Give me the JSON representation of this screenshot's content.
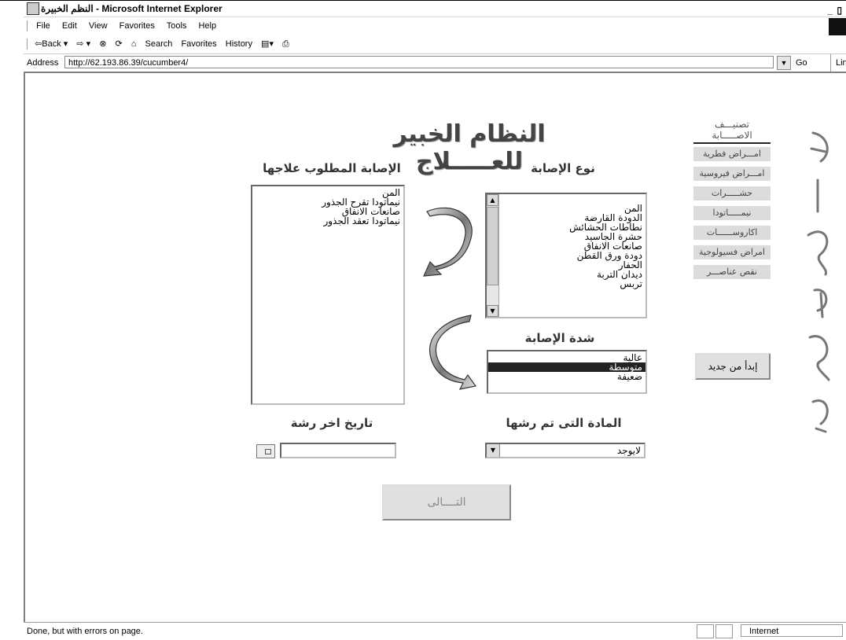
{
  "window": {
    "title": "النظم الخبيرة - Microsoft Internet Explorer",
    "controls": "_ ▯"
  },
  "menu": [
    "File",
    "Edit",
    "View",
    "Favorites",
    "Tools",
    "Help"
  ],
  "toolbar": {
    "back": "⇦Back ▾",
    "forward": "⇨ ▾",
    "stop": "⊗",
    "refresh": "⟳",
    "home": "⌂",
    "search": "Search",
    "favorites": "Favorites",
    "history": "History",
    "mail": "▤▾",
    "print": "⎙"
  },
  "address": {
    "label": "Address",
    "url": "http://62.193.86.39/cucumber4/",
    "go": "Go",
    "links": "Link"
  },
  "page": {
    "title": "النظام الخبير للعـــــلاج",
    "heading_type": "نوع الإصابة",
    "heading_required": "الإصابة المطلوب علاجها",
    "heading_severity": "شدة الإصابة",
    "heading_material": "المادة التى تم رشها",
    "heading_date": "تاريخ اخر رشة",
    "type_items": [
      "المن",
      "الدودة القارضة",
      "نطاطات الحشائش",
      "حشرة الجاسيد",
      "صانعات الانفاق",
      "دودة ورق القطن",
      "الحفار",
      "ديدان التربة",
      "تربس"
    ],
    "required_items": [
      "المن",
      "نيماتودا تقرح الجذور",
      "صانعات الانفاق",
      "نيماتودا تعقد الجذور"
    ],
    "severity_items": [
      "عالية",
      "متوسطة",
      "ضعيفة"
    ],
    "severity_selected": "متوسطة",
    "material_value": "لايوجد",
    "next_label": "التــــالى",
    "restart_label": "إبدأ من جديد"
  },
  "side_menu": {
    "title": "تصنيـــف الاصـــــابة",
    "items": [
      "امـــراض فطرية",
      "امـــراض فيروسية",
      "حشـــــرات",
      "نيمـــــاتودا",
      "اكاروســــــات",
      "امراض فسيولوجية",
      "نقص عناصـــر"
    ]
  },
  "status": {
    "text": "Done, but with errors on page.",
    "zone": "Internet"
  }
}
